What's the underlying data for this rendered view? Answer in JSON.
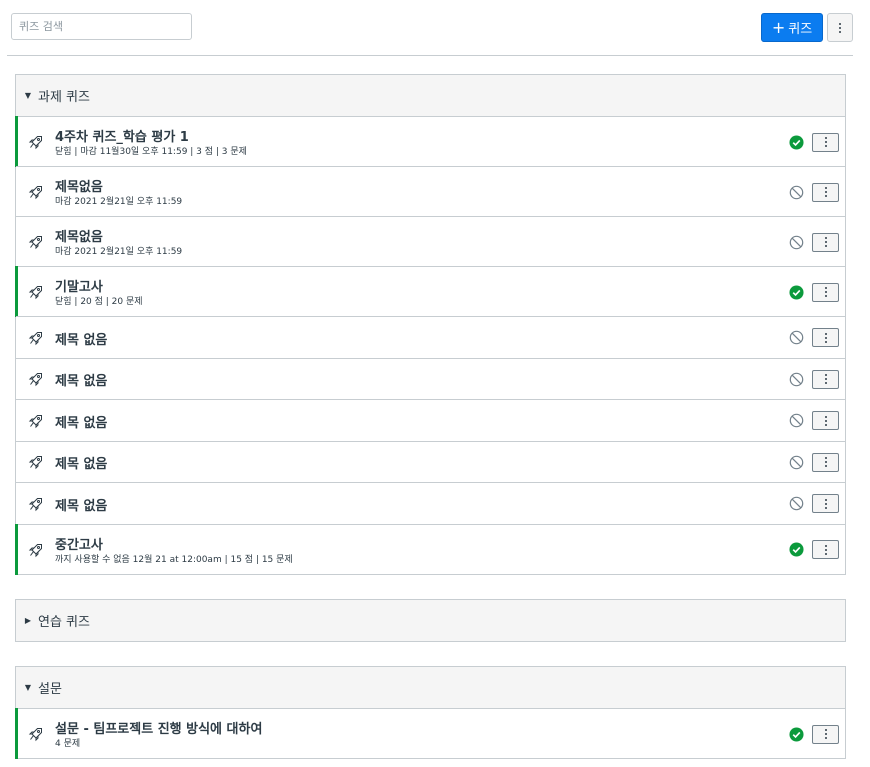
{
  "search": {
    "placeholder": "퀴즈 검색"
  },
  "toolbar": {
    "add_label": "퀴즈",
    "add_icon": "plus-icon",
    "more_icon": "kebab-icon"
  },
  "colors": {
    "published": "#0b9a3c",
    "primary": "#0b7cf0",
    "border": "#c7cdd1",
    "header_bg": "#f5f5f5"
  },
  "sections": [
    {
      "title": "과제 퀴즈",
      "expanded": true,
      "items": [
        {
          "title": "4주차 퀴즈_학습 평가 1",
          "meta": "닫힘  | 마감 11월30일 오후 11:59  | 3 점  | 3 문제",
          "status": "published"
        },
        {
          "title": "제목없음",
          "meta": "마감 2021 2월21일 오후 11:59",
          "status": "unpublished"
        },
        {
          "title": "제목없음",
          "meta": "마감 2021 2월21일 오후 11:59",
          "status": "unpublished"
        },
        {
          "title": "기말고사",
          "meta": "닫힘  | 20 점  | 20 문제",
          "status": "published"
        },
        {
          "title": "제목 없음",
          "meta": "",
          "status": "unpublished"
        },
        {
          "title": "제목 없음",
          "meta": "",
          "status": "unpublished"
        },
        {
          "title": "제목 없음",
          "meta": "",
          "status": "unpublished"
        },
        {
          "title": "제목 없음",
          "meta": "",
          "status": "unpublished"
        },
        {
          "title": "제목 없음",
          "meta": "",
          "status": "unpublished"
        },
        {
          "title": "중간고사",
          "meta": "까지 사용할 수 없음 12월 21 at 12:00am  | 15 점  | 15 문제",
          "status": "published"
        }
      ]
    },
    {
      "title": "연습 퀴즈",
      "expanded": false,
      "items": []
    },
    {
      "title": "설문",
      "expanded": true,
      "items": [
        {
          "title": "설문 - 팀프로젝트 진행 방식에 대하여",
          "meta": "4 문제",
          "status": "published"
        }
      ]
    }
  ]
}
